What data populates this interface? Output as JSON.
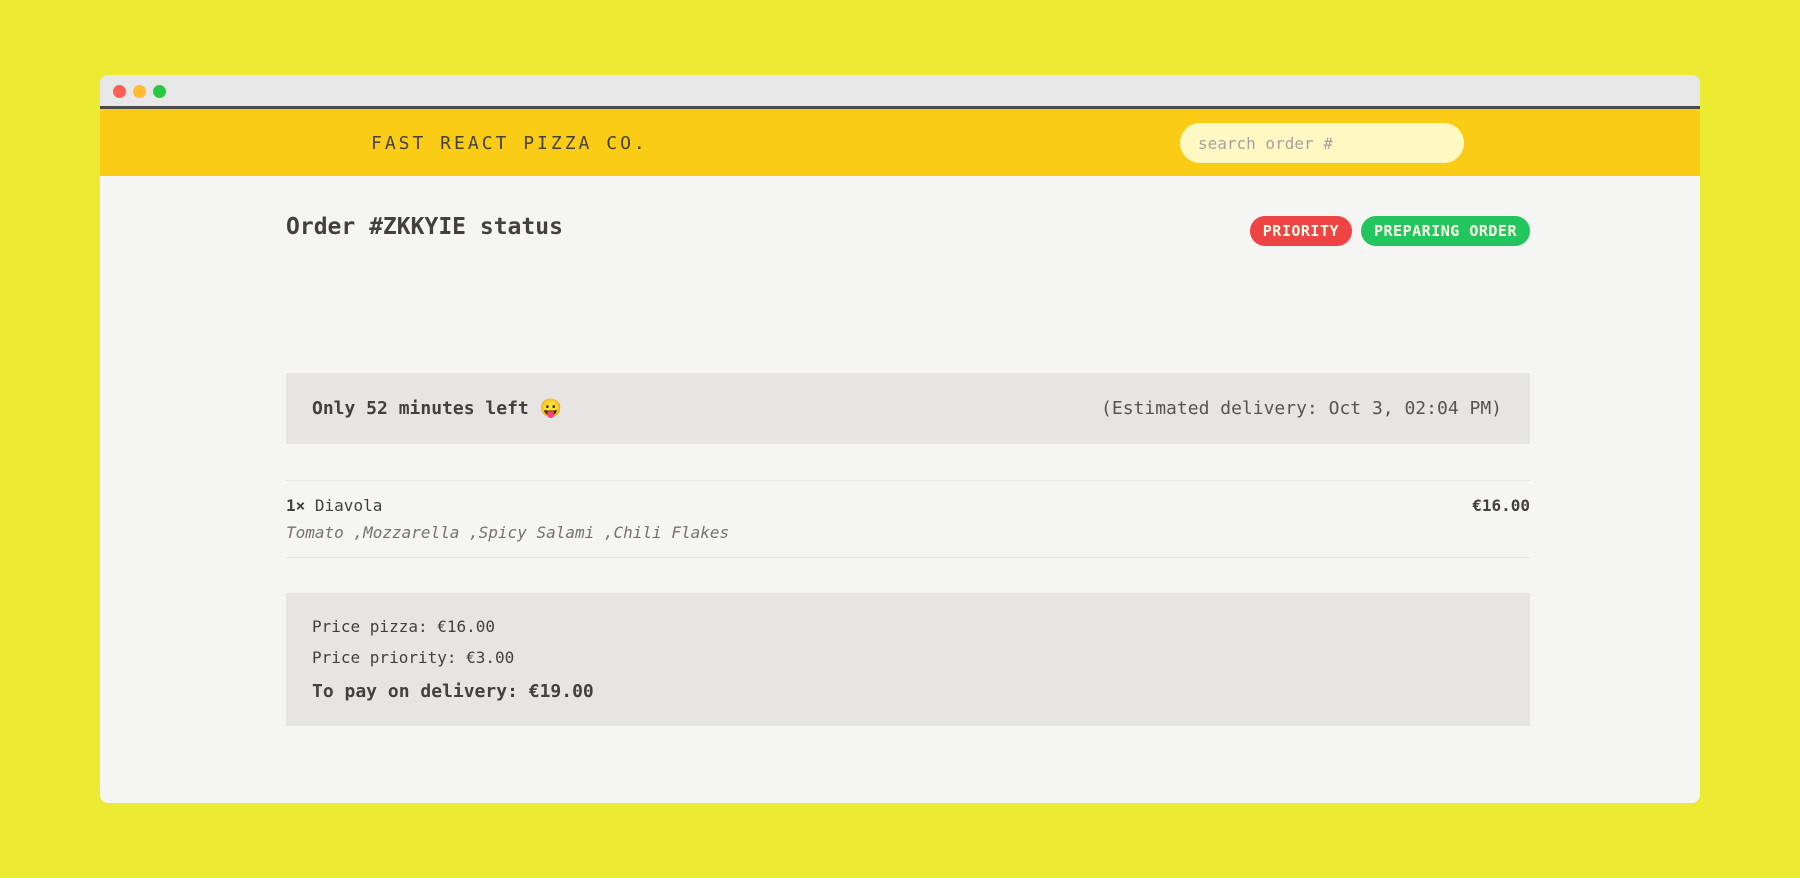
{
  "header": {
    "logo": "FAST REACT PIZZA CO.",
    "search_placeholder": "search order #"
  },
  "order": {
    "title": "Order #ZKKYIE status",
    "badges": [
      "PRIORITY",
      "PREPARING ORDER"
    ],
    "eta_left": "Only 52 minutes left 😛",
    "eta_right": "(Estimated delivery: Oct 3, 02:04 PM)"
  },
  "items": [
    {
      "qty": "1×",
      "name": "Diavola",
      "price": "€16.00",
      "ingredients": "Tomato ,Mozzarella ,Spicy Salami ,Chili Flakes"
    }
  ],
  "totals": {
    "price_pizza": "Price pizza: €16.00",
    "price_priority": "Price priority: €3.00",
    "to_pay": "To pay on delivery: €19.00"
  },
  "colors": {
    "background": "#ecea33",
    "header": "#facc15",
    "priority_badge": "#ef4444",
    "status_badge": "#22c55e"
  }
}
